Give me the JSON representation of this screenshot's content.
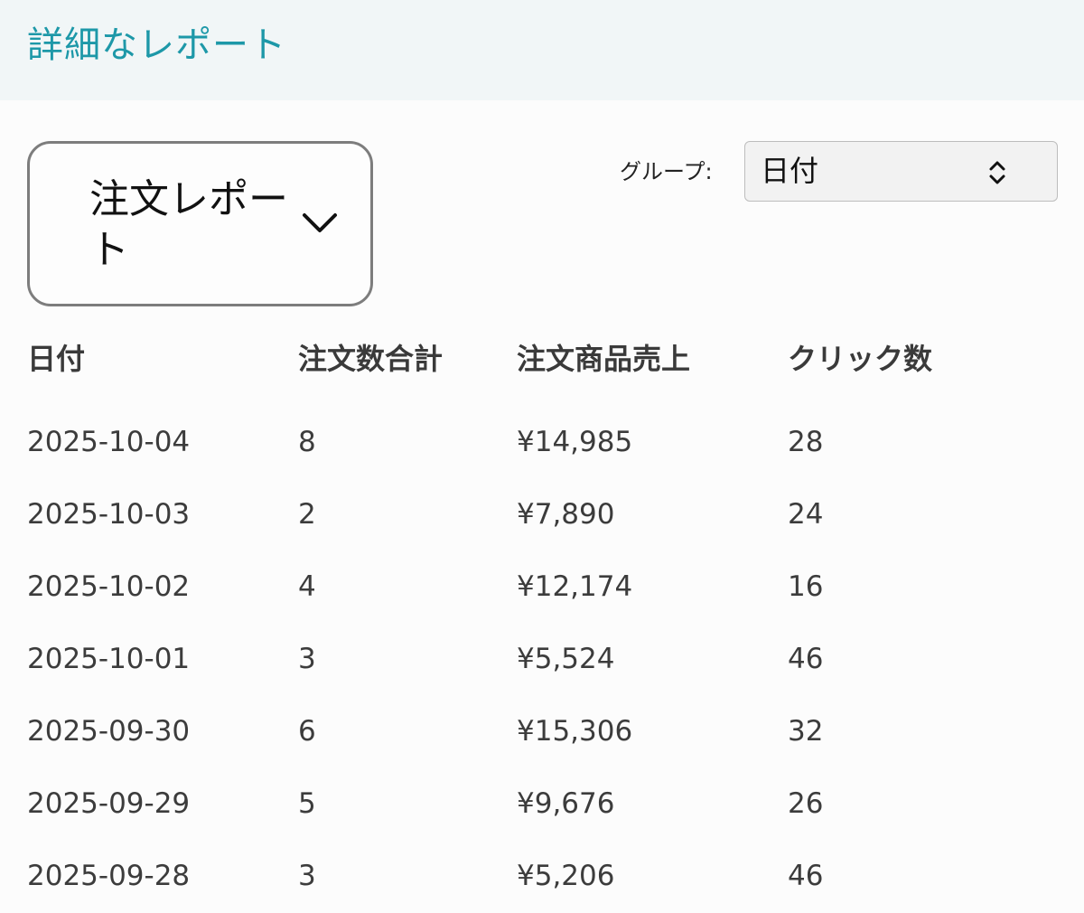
{
  "header": {
    "title": "詳細なレポート"
  },
  "report_selector": {
    "label": "注文レポート",
    "icon": "chevron-down-icon"
  },
  "group": {
    "label": "グループ:",
    "selected": "日付",
    "icon": "up-down-icon"
  },
  "table": {
    "columns": [
      "日付",
      "注文数合計",
      "注文商品売上",
      "クリック数"
    ],
    "rows": [
      [
        "2025-10-04",
        "8",
        "¥14,985",
        "28"
      ],
      [
        "2025-10-03",
        "2",
        "¥7,890",
        "24"
      ],
      [
        "2025-10-02",
        "4",
        "¥12,174",
        "16"
      ],
      [
        "2025-10-01",
        "3",
        "¥5,524",
        "46"
      ],
      [
        "2025-09-30",
        "6",
        "¥15,306",
        "32"
      ],
      [
        "2025-09-29",
        "5",
        "¥9,676",
        "26"
      ],
      [
        "2025-09-28",
        "3",
        "¥5,206",
        "46"
      ]
    ]
  },
  "colors": {
    "title": "#1d98a8",
    "header_bg": "#f1f6f7",
    "text": "#3c3c3c"
  }
}
